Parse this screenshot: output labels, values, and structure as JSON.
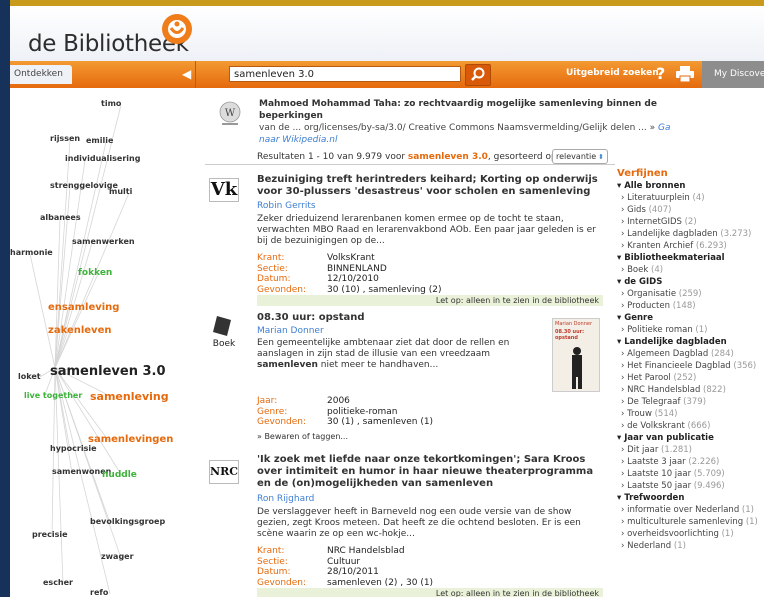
{
  "header": {
    "logo": "de Bibliotheek"
  },
  "toolbar": {
    "tab_ontdekken": "Ontdekken",
    "search_value": "samenleven 3.0",
    "advanced": "Uitgebreid zoeken",
    "my_discover": "My Discove"
  },
  "cloud": [
    {
      "t": "timo",
      "c": "#333",
      "fs": 8,
      "b": true
    },
    {
      "t": "rijssen",
      "c": "#333",
      "fs": 8,
      "b": true
    },
    {
      "t": "emilie",
      "c": "#333",
      "fs": 8,
      "b": true
    },
    {
      "t": "individualisering",
      "c": "#333",
      "fs": 8,
      "b": true
    },
    {
      "t": "strenggelovige",
      "c": "#333",
      "fs": 8,
      "b": true
    },
    {
      "t": "multi",
      "c": "#333",
      "fs": 8,
      "b": true
    },
    {
      "t": "albanees",
      "c": "#333",
      "fs": 8,
      "b": true
    },
    {
      "t": "samenwerken",
      "c": "#333",
      "fs": 8,
      "b": true
    },
    {
      "t": "harmonie",
      "c": "#333",
      "fs": 8,
      "b": true
    },
    {
      "t": "fokken",
      "c": "#3fb23c",
      "fs": 9,
      "b": true
    },
    {
      "t": "ensamleving",
      "c": "#e56a0d",
      "fs": 10,
      "b": true
    },
    {
      "t": "zakenleven",
      "c": "#e56a0d",
      "fs": 10,
      "b": true
    },
    {
      "t": "loket",
      "c": "#333",
      "fs": 8,
      "b": true
    },
    {
      "t": "samenleven 3.0",
      "c": "#222",
      "fs": 13,
      "b": true
    },
    {
      "t": "live together",
      "c": "#3fb23c",
      "fs": 8,
      "b": true
    },
    {
      "t": "samenleving",
      "c": "#e56a0d",
      "fs": 11,
      "b": true
    },
    {
      "t": "samenlevingen",
      "c": "#e56a0d",
      "fs": 10,
      "b": true
    },
    {
      "t": "hypocrisie",
      "c": "#333",
      "fs": 8,
      "b": true
    },
    {
      "t": "samenwonen",
      "c": "#333",
      "fs": 8,
      "b": true
    },
    {
      "t": "huddle",
      "c": "#3fb23c",
      "fs": 9,
      "b": true
    },
    {
      "t": "bevolkingsgroep",
      "c": "#333",
      "fs": 8,
      "b": true
    },
    {
      "t": "precisie",
      "c": "#333",
      "fs": 8,
      "b": true
    },
    {
      "t": "zwager",
      "c": "#333",
      "fs": 8,
      "b": true
    },
    {
      "t": "escher",
      "c": "#333",
      "fs": 8,
      "b": true
    },
    {
      "t": "refo",
      "c": "#333",
      "fs": 8,
      "b": true
    }
  ],
  "wiki": {
    "title": "Mahmoed Mohammad Taha: zo rechtvaardig mogelijke samenleving binnen de beperkingen",
    "line2": "van de ... org/licenses/by-sa/3.0/ Creative Commons Naamsvermelding/Gelijk delen ... »",
    "link1": "Ga",
    "link2": "naar Wikipedia.nl"
  },
  "results_bar": {
    "prefix": "Resultaten 1 - 10 van 9.979 voor",
    "query": "samenleven 3.0",
    "sorted": ", gesorteerd op:",
    "sort": "relevantie"
  },
  "results": [
    {
      "icon": "Vk",
      "title": "Bezuiniging treft herintreders keihard; Korting op onderwijs voor 30-plussers 'desastreus' voor scholen en samenleving",
      "author": "Robin Gerrits",
      "snippet": "Zeker drieduizend lerarenbanen komen ermee op de tocht te staan, verwachten MBO Raad en lerarenvakbond AOb. Een paar jaar geleden is er bij de bezuinigingen op de...",
      "meta": [
        [
          "Krant:",
          "VolksKrant"
        ],
        [
          "Sectie:",
          "BINNENLAND"
        ],
        [
          "Datum:",
          "12/10/2010"
        ],
        [
          "Gevonden:",
          "30 (10) , samenleving (2)"
        ]
      ],
      "avail": "Let op: alleen in te zien in de bibliotheek"
    },
    {
      "icon": "Boek",
      "title": "08.30 uur: opstand",
      "author": "Marian Donner",
      "snippet_a": "Een gemeentelijke ambtenaar ziet dat door de rellen en aanslagen in zijn stad de illusie van een vreedzaam ",
      "snippet_b": "samenleven",
      "snippet_c": " niet meer te handhaven...",
      "meta": [
        [
          "Jaar:",
          "2006"
        ],
        [
          "Genre:",
          "politieke-roman"
        ],
        [
          "Gevonden:",
          "30 (1) , samenleven (1)"
        ]
      ],
      "bewaren": "» Bewaren of taggen...",
      "cover_author": "Marian Donner",
      "cover_title": "08.30 uur: opstand"
    },
    {
      "icon": "NRC",
      "title": "'Ik zoek met liefde naar onze tekortkomingen'; Sara Kroos over intimiteit en humor in haar nieuwe theaterprogramma en de (on)mogelijkheden van samenleven",
      "author": "Ron Rijghard",
      "snippet": "De verslaggever heeft in Barneveld nog een oude versie van de show gezien, zegt Kroos meteen. Dat heeft ze die ochtend besloten. Er is een scène waarin ze op een wc-hokje...",
      "meta": [
        [
          "Krant:",
          "NRC Handelsblad"
        ],
        [
          "Sectie:",
          "Cultuur"
        ],
        [
          "Datum:",
          "28/10/2011"
        ],
        [
          "Gevonden:",
          "samenleven (2) , 30 (1)"
        ]
      ],
      "avail": "Let op: alleen in te zien in de bibliotheek"
    }
  ],
  "refine": {
    "title": "Verfijnen",
    "groups": [
      {
        "head": "Alle bronnen",
        "items": [
          [
            "Literatuurplein",
            "(4)"
          ],
          [
            "Gids",
            "(407)"
          ],
          [
            "InternetGIDS",
            "(2)"
          ],
          [
            "Landelijke dagbladen",
            "(3.273)"
          ],
          [
            "Kranten Archief",
            "(6.293)"
          ]
        ]
      },
      {
        "head": "Bibliotheekmateriaal",
        "items": [
          [
            "Boek",
            "(4)"
          ]
        ]
      },
      {
        "head": "de GIDS",
        "items": [
          [
            "Organisatie",
            "(259)"
          ],
          [
            "Producten",
            "(148)"
          ]
        ]
      },
      {
        "head": "Genre",
        "items": [
          [
            "Politieke roman",
            "(1)"
          ]
        ]
      },
      {
        "head": "Landelijke dagbladen",
        "items": [
          [
            "Algemeen Dagblad",
            "(284)"
          ],
          [
            "Het Financieele Dagblad",
            "(356)"
          ],
          [
            "Het Parool",
            "(252)"
          ],
          [
            "NRC Handelsblad",
            "(822)"
          ],
          [
            "De Telegraaf",
            "(379)"
          ],
          [
            "Trouw",
            "(514)"
          ],
          [
            "de Volkskrant",
            "(666)"
          ]
        ]
      },
      {
        "head": "Jaar van publicatie",
        "items": [
          [
            "Dit jaar",
            "(1.281)"
          ],
          [
            "Laatste 3 jaar",
            "(2.226)"
          ],
          [
            "Laatste 10 jaar",
            "(5.709)"
          ],
          [
            "Laatste 50 jaar",
            "(9.496)"
          ]
        ]
      },
      {
        "head": "Trefwoorden",
        "items": [
          [
            "informatie over Nederland",
            "(1)"
          ],
          [
            "multiculturele samenleving",
            "(1)"
          ],
          [
            "overheidsvoorlichting",
            "(1)"
          ],
          [
            "Nederland",
            "(1)"
          ]
        ]
      }
    ]
  },
  "colors": {
    "accent": "#e56a0d",
    "link": "#3f7fd0",
    "green": "#3fb23c"
  }
}
